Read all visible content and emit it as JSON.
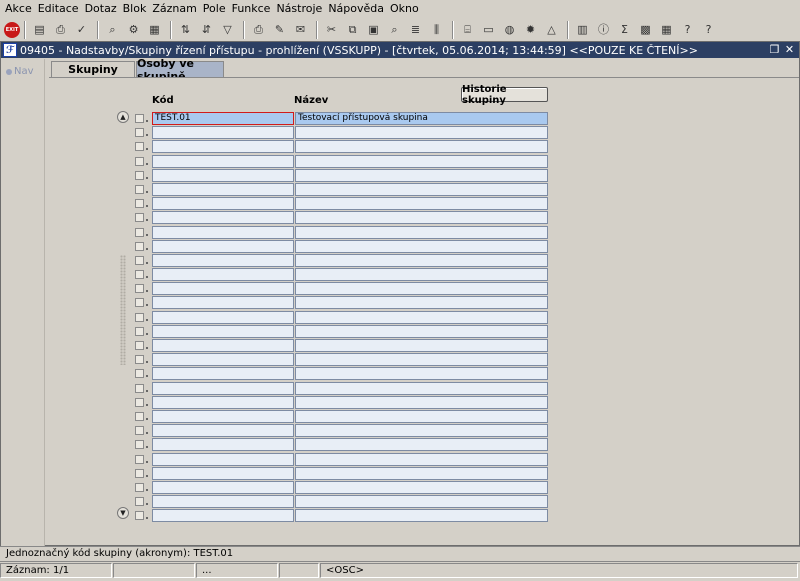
{
  "menu": [
    "Akce",
    "Editace",
    "Dotaz",
    "Blok",
    "Záznam",
    "Pole",
    "Funkce",
    "Nástroje",
    "Nápověda",
    "Okno"
  ],
  "toolbar": {
    "exit_label": "EXIT",
    "groups": [
      [
        "save-icon",
        "print-icon",
        "accept-icon"
      ],
      [
        "query-enter-icon",
        "query-execute-icon",
        "query-count-icon"
      ],
      [
        "sort-icon",
        "sort-descending-icon",
        "filter-icon"
      ],
      [
        "print-form-icon",
        "edit-icon",
        "mail-icon"
      ],
      [
        "cut-icon",
        "copy-icon",
        "paste-icon",
        "find-icon",
        "list-icon",
        "columns-icon"
      ],
      [
        "attach-icon",
        "document-icon",
        "globe-icon",
        "settings-icon",
        "warning-icon"
      ],
      [
        "chart-icon",
        "info-icon",
        "sum-icon",
        "excel-icon",
        "calculator-icon",
        "help-icon",
        "context-help-icon"
      ]
    ]
  },
  "window": {
    "title": "09405 - Nadstavby/Skupiny řízení přístupu - prohlížení (VSSKUPP) - [čtvrtek, 05.06.2014; 13:44:59] <<POUZE KE ČTENÍ>>",
    "restore_icon": "❐",
    "close_icon": "✕"
  },
  "nav": {
    "label": "Nav"
  },
  "tabs": [
    "Skupiny",
    "Osoby ve skupině"
  ],
  "form": {
    "history_button": "Historie skupiny",
    "col_kod": "Kód",
    "col_nazev": "Název",
    "rows": [
      {
        "kod": "TEST.01",
        "nazev": "Testovací přístupová skupina"
      },
      {
        "kod": "",
        "nazev": ""
      },
      {
        "kod": "",
        "nazev": ""
      },
      {
        "kod": "",
        "nazev": ""
      },
      {
        "kod": "",
        "nazev": ""
      },
      {
        "kod": "",
        "nazev": ""
      },
      {
        "kod": "",
        "nazev": ""
      },
      {
        "kod": "",
        "nazev": ""
      },
      {
        "kod": "",
        "nazev": ""
      },
      {
        "kod": "",
        "nazev": ""
      },
      {
        "kod": "",
        "nazev": ""
      },
      {
        "kod": "",
        "nazev": ""
      },
      {
        "kod": "",
        "nazev": ""
      },
      {
        "kod": "",
        "nazev": ""
      },
      {
        "kod": "",
        "nazev": ""
      },
      {
        "kod": "",
        "nazev": ""
      },
      {
        "kod": "",
        "nazev": ""
      },
      {
        "kod": "",
        "nazev": ""
      },
      {
        "kod": "",
        "nazev": ""
      },
      {
        "kod": "",
        "nazev": ""
      },
      {
        "kod": "",
        "nazev": ""
      },
      {
        "kod": "",
        "nazev": ""
      },
      {
        "kod": "",
        "nazev": ""
      },
      {
        "kod": "",
        "nazev": ""
      },
      {
        "kod": "",
        "nazev": ""
      },
      {
        "kod": "",
        "nazev": ""
      },
      {
        "kod": "",
        "nazev": ""
      },
      {
        "kod": "",
        "nazev": ""
      },
      {
        "kod": "",
        "nazev": ""
      }
    ]
  },
  "status": {
    "message": "Jednoznačný kód skupiny (akronym): TEST.01",
    "record": "Záznam: 1/1",
    "field2": "",
    "field3": "...",
    "field4": "",
    "field5": "<OSC>"
  }
}
